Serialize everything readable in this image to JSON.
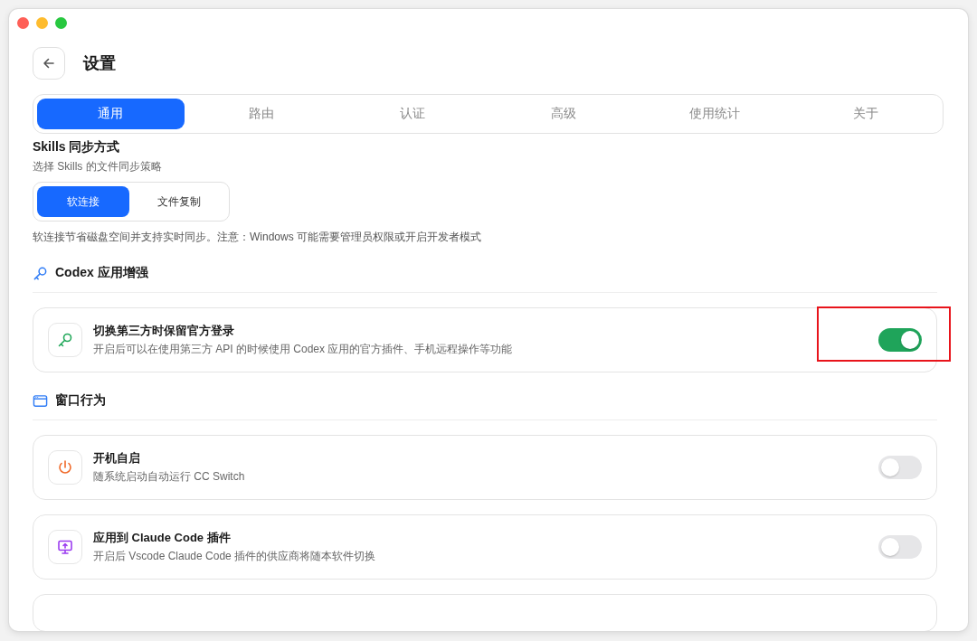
{
  "window": {
    "title": "设置"
  },
  "tabs": [
    {
      "label": "通用",
      "selected": true
    },
    {
      "label": "路由",
      "selected": false
    },
    {
      "label": "认证",
      "selected": false
    },
    {
      "label": "高级",
      "selected": false
    },
    {
      "label": "使用统计",
      "selected": false
    },
    {
      "label": "关于",
      "selected": false
    }
  ],
  "sections": [
    {
      "kind": "choice",
      "title": "Skills 同步方式",
      "description": "选择 Skills 的文件同步策略",
      "options": [
        {
          "label": "软连接",
          "selected": true
        },
        {
          "label": "文件复制",
          "selected": false
        }
      ],
      "note": "软连接节省磁盘空间并支持实时同步。注意：Windows 可能需要管理员权限或开启开发者模式"
    },
    {
      "kind": "toggles",
      "title": "Codex 应用增强",
      "items": [
        {
          "title": "切换第三方时保留官方登录",
          "description": "开启后可以在使用第三方 API 的时候使用 Codex 应用的官方插件、手机远程操作等功能",
          "on": true,
          "highlighted": true
        }
      ]
    },
    {
      "kind": "toggles",
      "title": "窗口行为",
      "items": [
        {
          "title": "开机自启",
          "description": "随系统启动自动运行 CC Switch",
          "on": false,
          "highlighted": false
        },
        {
          "title": "应用到 Claude Code 插件",
          "description": "开启后 Vscode Claude Code 插件的供应商将随本软件切换",
          "on": false,
          "highlighted": false
        }
      ]
    }
  ]
}
